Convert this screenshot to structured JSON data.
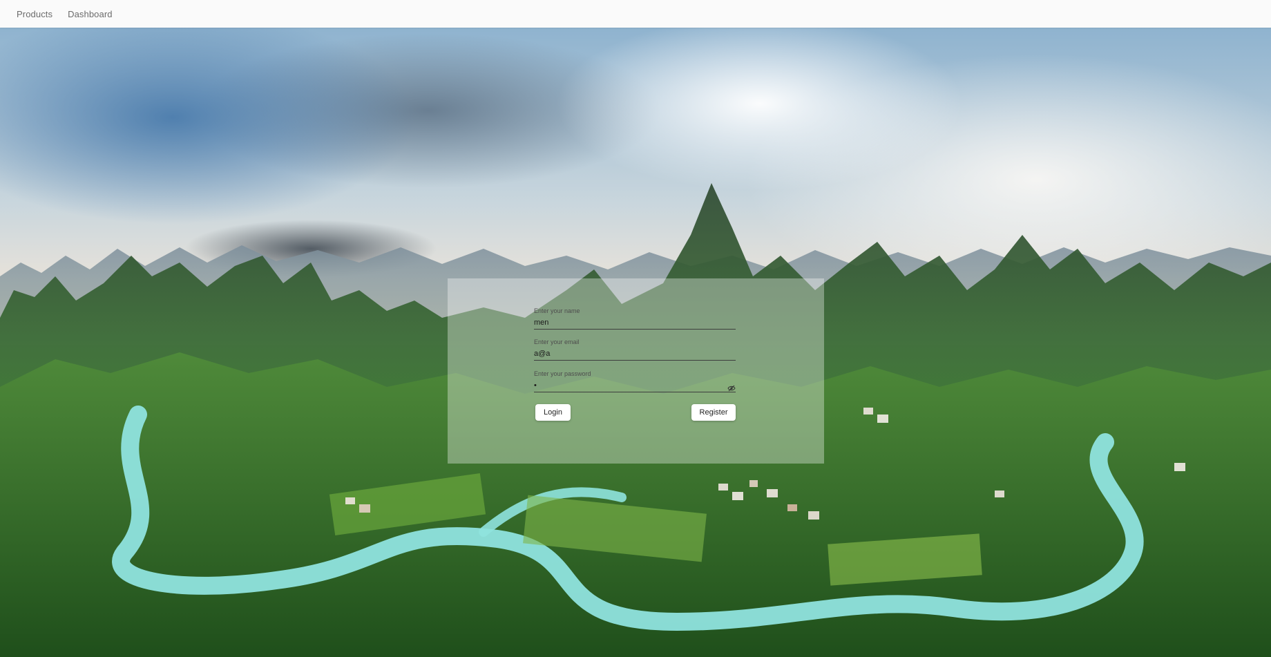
{
  "nav": {
    "links": [
      {
        "label": "Products"
      },
      {
        "label": "Dashboard"
      }
    ]
  },
  "form": {
    "name": {
      "label": "Enter your name",
      "value": "men"
    },
    "email": {
      "label": "Enter your email",
      "value": "a@a"
    },
    "password": {
      "label": "Enter your password",
      "value": "•",
      "icon": "eye-off-icon"
    },
    "login_label": "Login",
    "register_label": "Register"
  },
  "colors": {
    "nav_background": "#fafafa",
    "nav_text": "#6b6b6b",
    "card_background": "rgba(255,255,255,0.34)",
    "button_background": "#ffffff"
  }
}
